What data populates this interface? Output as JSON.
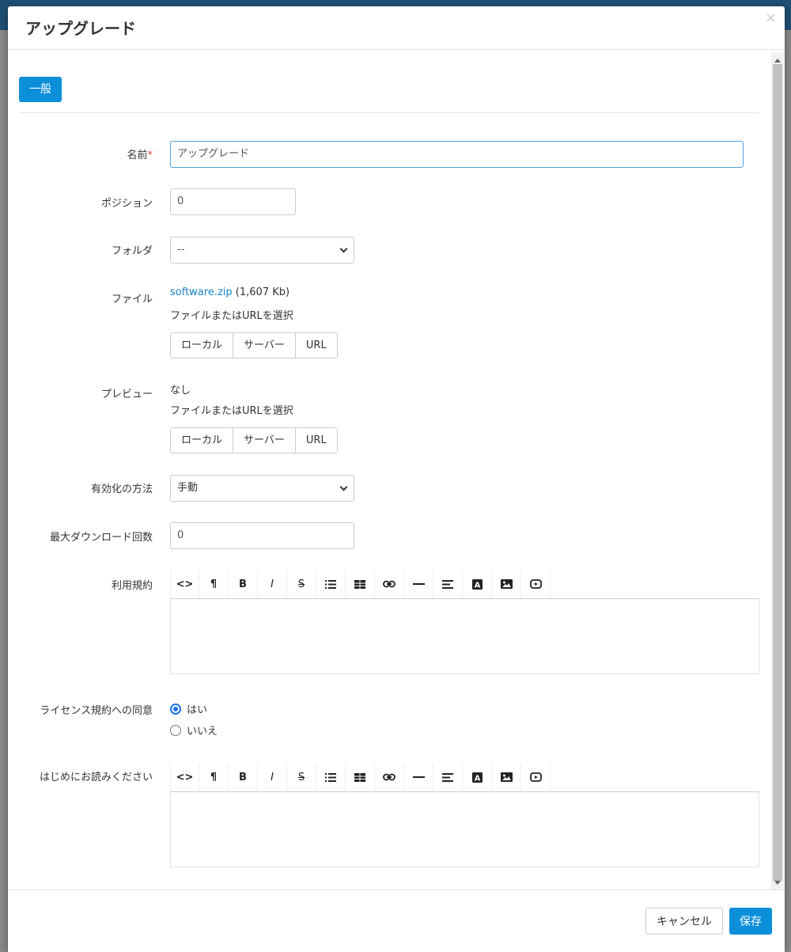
{
  "modal": {
    "title": "アップグレード",
    "close": "×"
  },
  "tabs": [
    {
      "label": "一般"
    }
  ],
  "form": {
    "name": {
      "label": "名前",
      "required": "*",
      "value": "アップグレード"
    },
    "position": {
      "label": "ポジション",
      "value": "0"
    },
    "folder": {
      "label": "フォルダ",
      "selected": "--"
    },
    "file": {
      "label": "ファイル",
      "filename": "software.zip",
      "size": "(1,607 Kb)",
      "hint": "ファイルまたはURLを選択",
      "buttons": [
        "ローカル",
        "サーバー",
        "URL"
      ]
    },
    "preview": {
      "label": "プレビュー",
      "value": "なし",
      "hint": "ファイルまたはURLを選択",
      "buttons": [
        "ローカル",
        "サーバー",
        "URL"
      ]
    },
    "activation": {
      "label": "有効化の方法",
      "selected": "手動"
    },
    "max_downloads": {
      "label": "最大ダウンロード回数",
      "value": "0"
    },
    "terms": {
      "label": "利用規約"
    },
    "license_agreement": {
      "label": "ライセンス規約への同意",
      "options": [
        "はい",
        "いいえ"
      ],
      "selected": "はい"
    },
    "readme": {
      "label": "はじめにお読みください"
    }
  },
  "footer": {
    "cancel_label": "キャンセル",
    "save_label": "保存"
  },
  "colors": {
    "primary": "#0b8fd9",
    "link": "#1a83c8",
    "required": "#e74c3c"
  }
}
